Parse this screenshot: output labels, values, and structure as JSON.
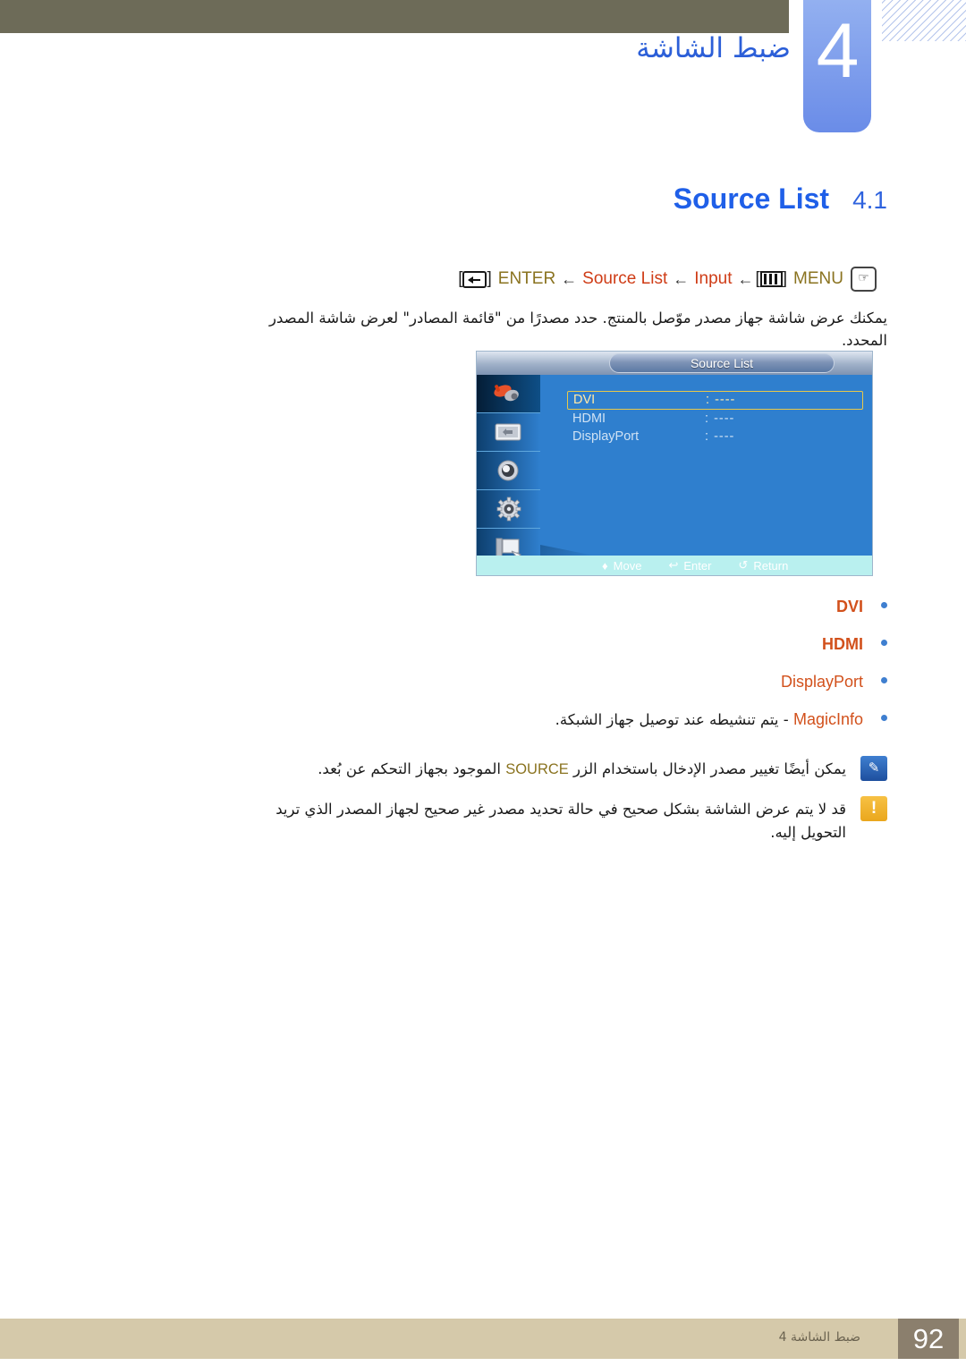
{
  "header": {
    "chapter_number": "4",
    "chapter_title": "ضبط الشاشة"
  },
  "section": {
    "number": "4.1",
    "name": "Source List"
  },
  "menu_path": {
    "enter_key_icon": "enter-key-icon",
    "enter_label": "ENTER",
    "arrow1": "←",
    "source_list_label": "Source List",
    "arrow2": "←",
    "input_label": "Input",
    "arrow3": "←",
    "bracket_open": "[",
    "menu_bars_icon": "menu-bars-icon",
    "bracket_close": "]",
    "menu_label": "MENU",
    "hand_icon": "hand-press-icon"
  },
  "description": "يمكنك عرض شاشة جهاز مصدر موّصل بالمنتج. حدد مصدرًا من \"قائمة المصادر\" لعرض شاشة المصدر المحدد.",
  "osd": {
    "title": "Source List",
    "sidebar_icons": [
      "input-source-icon",
      "picture-screen-icon",
      "sound-speaker-icon",
      "setup-gear-icon",
      "multi-control-icon"
    ],
    "rows": [
      {
        "label": "DVI",
        "separator": ":",
        "value": "----",
        "selected": true
      },
      {
        "label": "HDMI",
        "separator": ":",
        "value": "----",
        "selected": false
      },
      {
        "label": "DisplayPort",
        "separator": ":",
        "value": "----",
        "selected": false
      }
    ],
    "footer": [
      {
        "icon": "updown-arrow-icon",
        "glyph": "♦",
        "label": "Move"
      },
      {
        "icon": "enter-key-icon",
        "glyph": "↩",
        "label": "Enter"
      },
      {
        "icon": "return-arrow-icon",
        "glyph": "↺",
        "label": "Return"
      }
    ]
  },
  "bullets": [
    {
      "text": "DVI",
      "bold": true,
      "mixed": false
    },
    {
      "text": "HDMI",
      "bold": true,
      "mixed": false
    },
    {
      "text": "DisplayPort",
      "bold": false,
      "mixed": false
    },
    {
      "accent": "MagicInfo",
      "rest": " - يتم تنشيطه عند توصيل جهاز الشبكة.",
      "mixed": true
    }
  ],
  "notes": {
    "info": {
      "icon": "note-info-icon",
      "glyph": "✎",
      "before": "يمكن أيضًا تغيير مصدر الإدخال باستخدام الزر ",
      "accent": "SOURCE",
      "after": " الموجود بجهاز التحكم عن بُعد."
    },
    "warning": {
      "icon": "warning-icon",
      "glyph": "!",
      "text": "قد لا يتم عرض الشاشة بشكل صحيح في حالة تحديد مصدر غير صحيح لجهاز المصدر الذي تريد التحويل إليه."
    }
  },
  "footer": {
    "breadcrumb": "ضبط الشاشة 4",
    "page_number": "92"
  },
  "colors": {
    "header_band": "#6d6b58",
    "chapter_tab": "#6a8ce8",
    "title_blue": "#1f5fe8",
    "path_olive": "#8a7320",
    "path_red": "#cf3c16",
    "bullet_orange": "#d2511c",
    "osd_blue": "#2f7fce",
    "osd_highlight": "#e8c84a",
    "footer_tan": "#d5c9aa",
    "footer_page_box": "#8b7f6d"
  }
}
